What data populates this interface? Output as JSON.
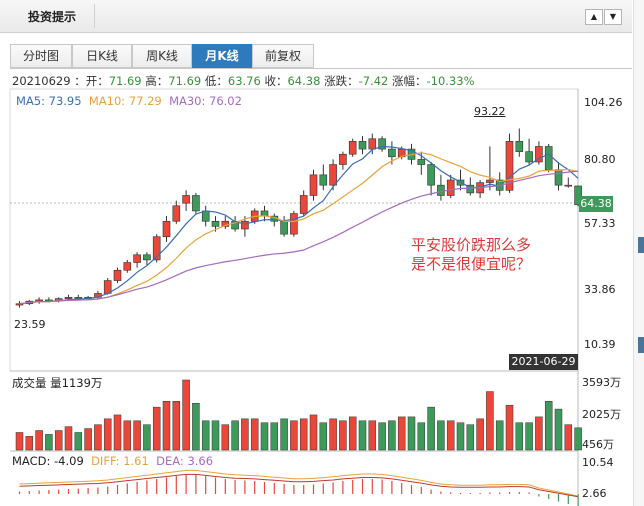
{
  "header": {
    "title": "投资提示",
    "up_arrow": "▲",
    "down_arrow": "▼"
  },
  "tabs": [
    {
      "label": "分时图",
      "active": false
    },
    {
      "label": "日K线",
      "active": false
    },
    {
      "label": "周K线",
      "active": false
    },
    {
      "label": "月K线",
      "active": true
    },
    {
      "label": "前复权",
      "active": false
    }
  ],
  "quote": {
    "date": "20210629",
    "open_label": "开：",
    "open": "71.69",
    "high_label": "高：",
    "high": "71.69",
    "low_label": "低：",
    "low": "63.76",
    "close_label": "收：",
    "close": "64.38",
    "change_label": "涨跌：",
    "change": "-7.42",
    "pct_label": "涨幅：",
    "pct": "-10.33%"
  },
  "ma": {
    "ma5_label": "MA5: 73.95",
    "ma10_label": "MA10: 77.29",
    "ma30_label": "MA30: 76.02",
    "ma5_color": "#3a6fb0",
    "ma10_color": "#e8a23c",
    "ma30_color": "#a56bbf"
  },
  "price_axis": [
    "104.26",
    "80.80",
    "57.33",
    "33.86",
    "10.39"
  ],
  "current_price_badge": "64.38",
  "high_marker": "93.22",
  "low_marker": "23.59",
  "date_badge": "2021-06-29",
  "annotation": [
    "平安股价跌那么多",
    "是不是很便宜呢？"
  ],
  "volume": {
    "title": "成交量 量1139万",
    "axis": [
      "3593万",
      "2025万",
      "456万"
    ]
  },
  "macd": {
    "macd_label": "MACD: -4.09",
    "diff_label": "DIFF: 1.61",
    "dea_label": "DEA: 3.66",
    "axis": [
      "10.54",
      "2.66"
    ]
  },
  "colors": {
    "up": "#e8473a",
    "down": "#3d9a5a",
    "accent": "#2d7bbd"
  },
  "chart_data": {
    "type": "candlestick",
    "ylim": [
      10.39,
      104.26
    ],
    "candles": [
      [
        25.5,
        27,
        24.5,
        26
      ],
      [
        26,
        27.5,
        25.5,
        27
      ],
      [
        27,
        28.5,
        26,
        27.5
      ],
      [
        27.5,
        28.5,
        26.5,
        27
      ],
      [
        27,
        28.5,
        26.5,
        28
      ],
      [
        28,
        29.5,
        27,
        28.5
      ],
      [
        28.5,
        29.5,
        27.5,
        28
      ],
      [
        28,
        29,
        27.5,
        28.5
      ],
      [
        28.5,
        31,
        28,
        30
      ],
      [
        30,
        36,
        29.5,
        35
      ],
      [
        35,
        40,
        34,
        39
      ],
      [
        39,
        43,
        38,
        42
      ],
      [
        42,
        46,
        40,
        45
      ],
      [
        45,
        46,
        41,
        43
      ],
      [
        43,
        53,
        42,
        52
      ],
      [
        52,
        60,
        50,
        58
      ],
      [
        58,
        66,
        57,
        64
      ],
      [
        65,
        70,
        62,
        68
      ],
      [
        68,
        69,
        61,
        62
      ],
      [
        62,
        64,
        56,
        58
      ],
      [
        58,
        60,
        54,
        56
      ],
      [
        56,
        60,
        55,
        58
      ],
      [
        58,
        60,
        54,
        55
      ],
      [
        55,
        60,
        52,
        58
      ],
      [
        58,
        63,
        57,
        62
      ],
      [
        62,
        64,
        58,
        60
      ],
      [
        60,
        61,
        56,
        58
      ],
      [
        58,
        60,
        52,
        53
      ],
      [
        53,
        62,
        52,
        61
      ],
      [
        61,
        70,
        60,
        68
      ],
      [
        68,
        78,
        66,
        76
      ],
      [
        76,
        80,
        70,
        72
      ],
      [
        72,
        82,
        70,
        80
      ],
      [
        80,
        85,
        78,
        84
      ],
      [
        84,
        90,
        83,
        89
      ],
      [
        89,
        91,
        84,
        86
      ],
      [
        86,
        92,
        84,
        90
      ],
      [
        90,
        91,
        85,
        86
      ],
      [
        86,
        89,
        80,
        83
      ],
      [
        83,
        87,
        82,
        86
      ],
      [
        86,
        88,
        80,
        82
      ],
      [
        82,
        85,
        76,
        80
      ],
      [
        80,
        81,
        68,
        72
      ],
      [
        72,
        76,
        66,
        68
      ],
      [
        68,
        76,
        67,
        74
      ],
      [
        74,
        78,
        70,
        72
      ],
      [
        72,
        75,
        68,
        69
      ],
      [
        69,
        74,
        67,
        73
      ],
      [
        73,
        87,
        70,
        74
      ],
      [
        74,
        77,
        68,
        70
      ],
      [
        70,
        92,
        69,
        89
      ],
      [
        89,
        94,
        83,
        85
      ],
      [
        85,
        90,
        80,
        81
      ],
      [
        81,
        89,
        80,
        87
      ],
      [
        87,
        88,
        77,
        78
      ],
      [
        78,
        81,
        70,
        72
      ],
      [
        72,
        75,
        71,
        72
      ],
      [
        71.69,
        71.69,
        63.76,
        64.38
      ]
    ],
    "volume": [
      900,
      700,
      1000,
      800,
      1000,
      1200,
      900,
      1100,
      1300,
      1600,
      1800,
      1500,
      1500,
      1300,
      2200,
      2500,
      2500,
      3593,
      2400,
      1500,
      1500,
      1300,
      1500,
      1600,
      1600,
      1400,
      1400,
      1600,
      1500,
      1600,
      1800,
      1400,
      1600,
      1500,
      1700,
      1500,
      1500,
      1400,
      1500,
      1700,
      1700,
      1400,
      2200,
      1500,
      1500,
      1400,
      1300,
      1600,
      3000,
      1500,
      2300,
      1400,
      1400,
      1700,
      2500,
      2100,
      1300,
      1139
    ],
    "macd_hist": [
      0.5,
      0.6,
      0.7,
      0.8,
      0.9,
      1,
      1.1,
      1.2,
      1.3,
      1.5,
      1.8,
      2.1,
      2.4,
      2.7,
      3,
      3.3,
      3.6,
      3.9,
      3.9,
      3.6,
      3.3,
      3,
      2.8,
      2.7,
      2.6,
      2.4,
      2.2,
      2,
      1.8,
      1.8,
      1.9,
      2.1,
      2.3,
      2.6,
      2.8,
      3,
      3,
      2.9,
      2.6,
      2.2,
      1.8,
      1.4,
      0.9,
      0.5,
      0.3,
      0.2,
      0.2,
      0.2,
      0.3,
      0.3,
      0.4,
      0.4,
      0.3,
      -0.5,
      -1,
      -1.5,
      -2,
      -2.5
    ]
  }
}
